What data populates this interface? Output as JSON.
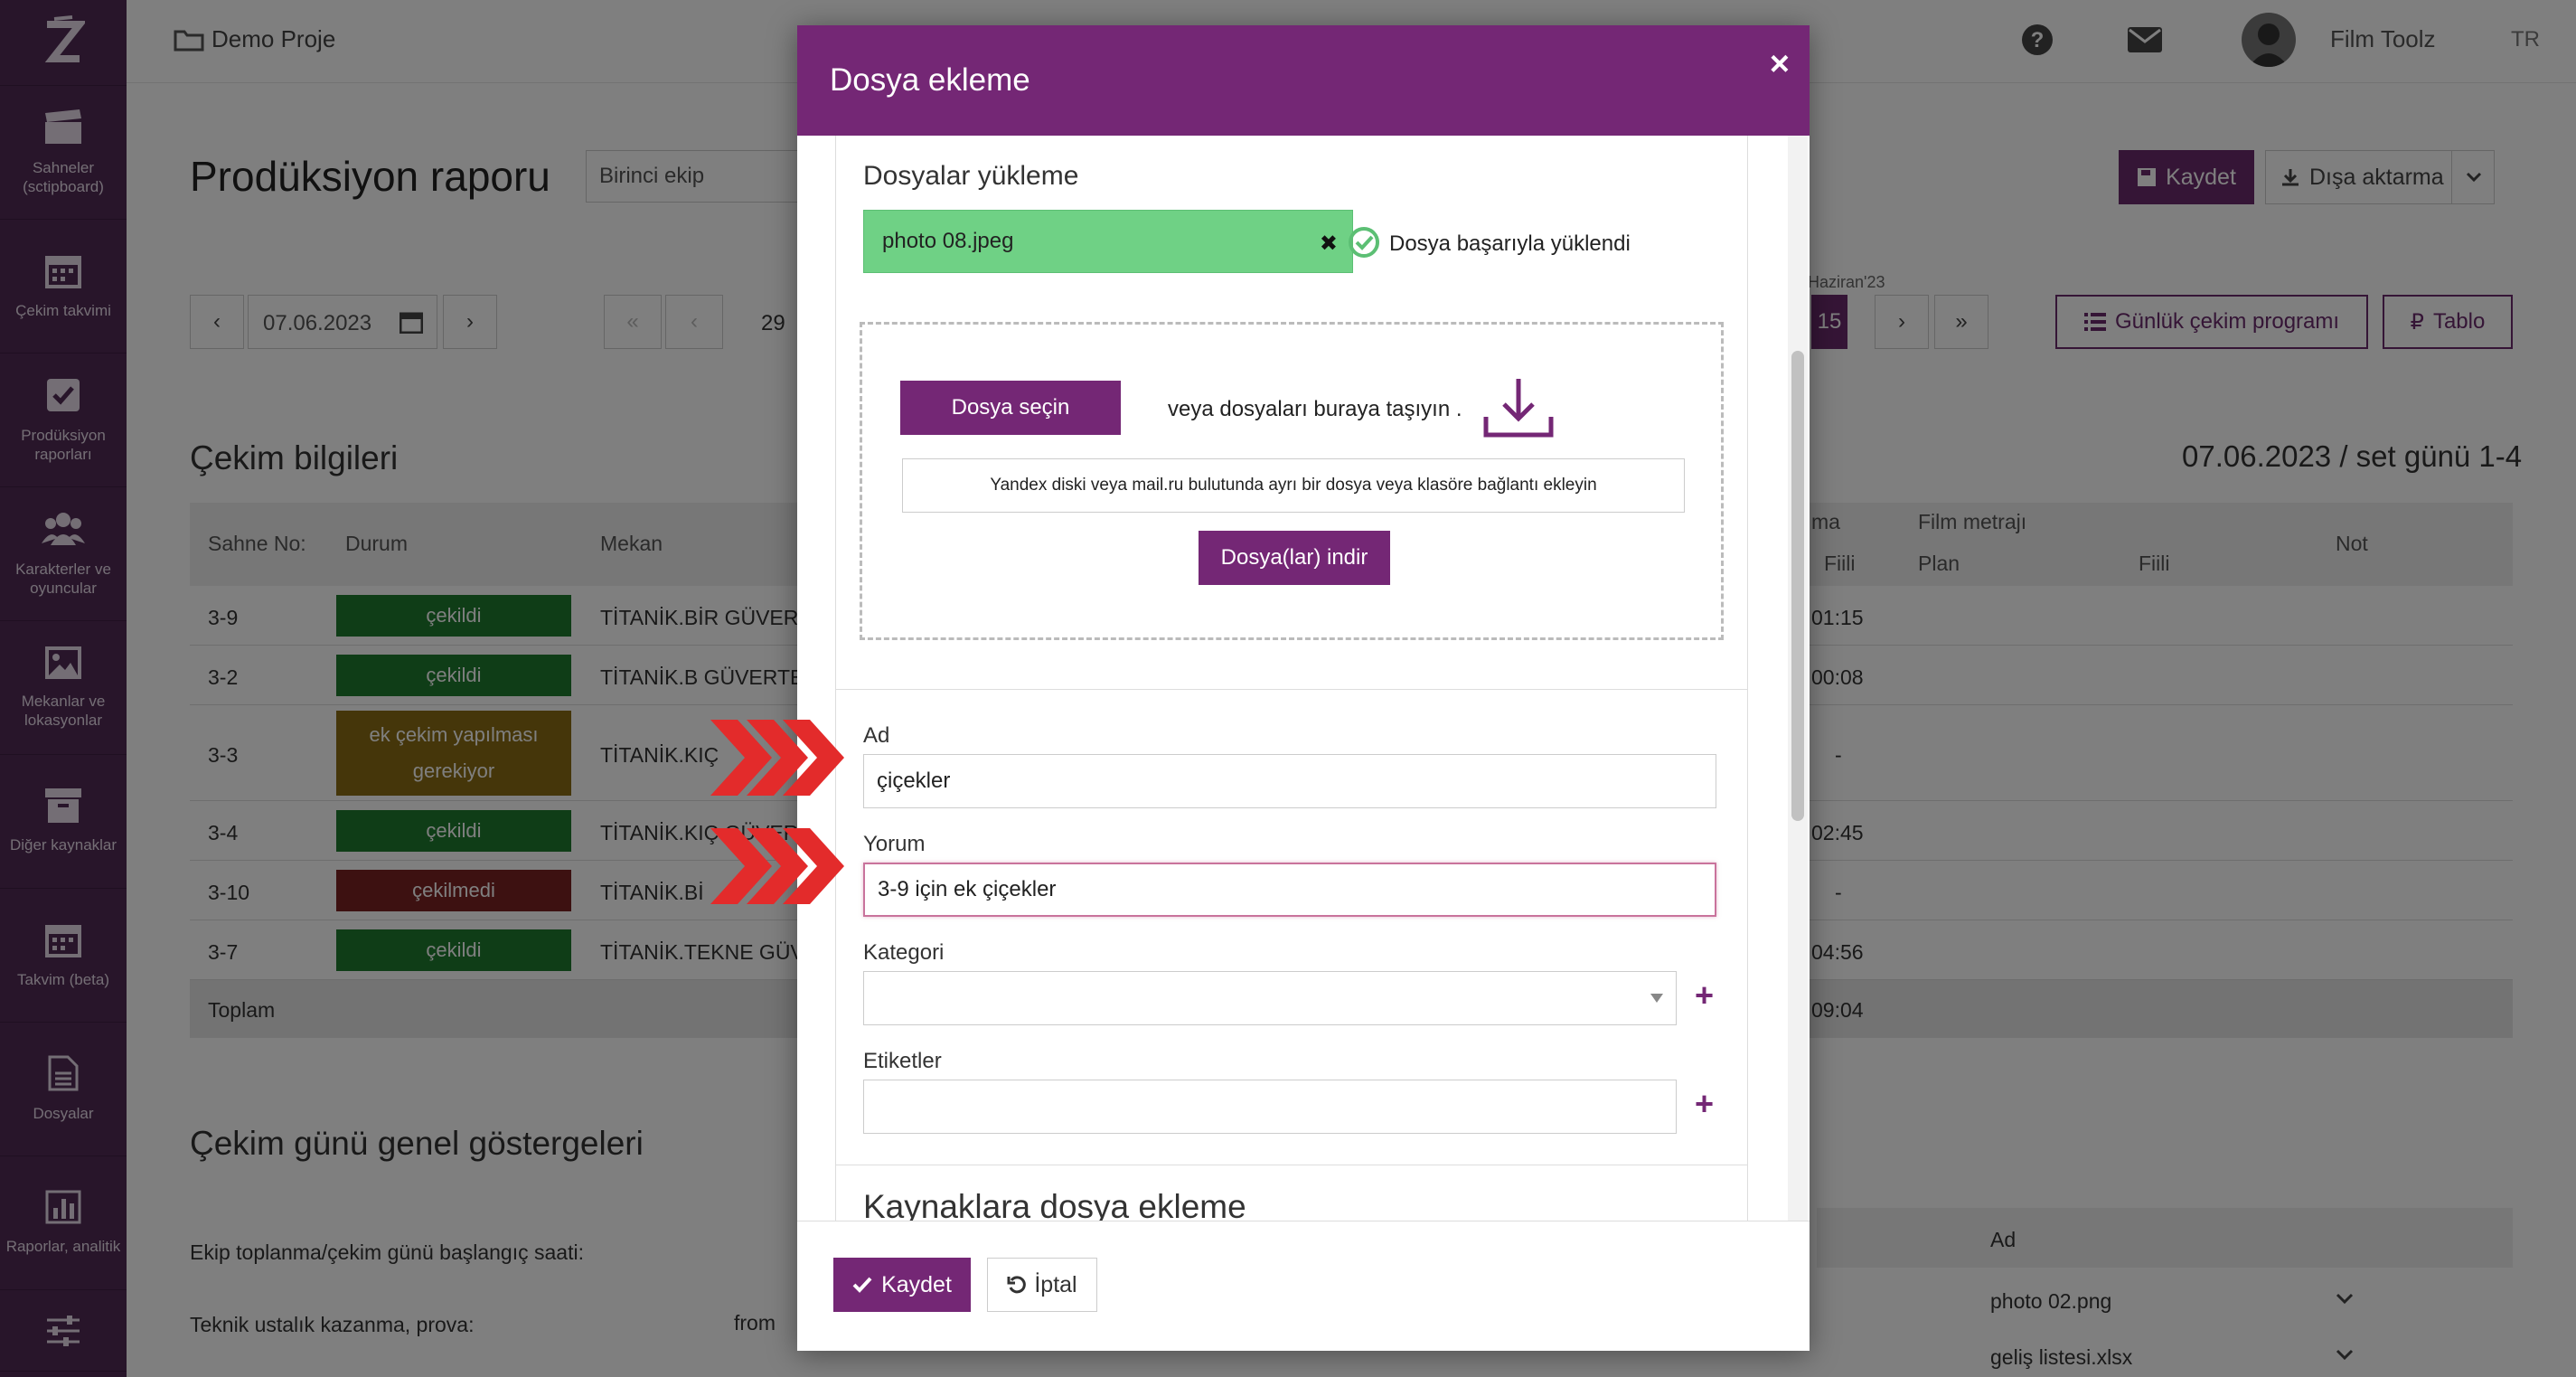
{
  "app": {
    "project_name": "Demo Proje",
    "user_name": "Film Toolz",
    "language": "TR"
  },
  "sidebar": {
    "items": [
      {
        "label": "Sahneler (sctipboard)"
      },
      {
        "label": "Çekim takvimi"
      },
      {
        "label": "Prodüksiyon raporları"
      },
      {
        "label": "Karakterler ve oyuncular"
      },
      {
        "label": "Mekanlar ve lokasyonlar"
      },
      {
        "label": "Diğer kaynaklar"
      },
      {
        "label": "Takvim (beta)"
      },
      {
        "label": "Dosyalar"
      },
      {
        "label": "Raporlar, analitik"
      }
    ]
  },
  "page": {
    "title": "Prodüksiyon raporu",
    "crew_select": "Birinci ekip",
    "save_label": "Kaydet",
    "export_label": "Dışa aktarma",
    "date_value": "07.06.2023",
    "day_number": "29",
    "month_label": "Haziran'23",
    "day_15": "15",
    "daily_schedule_label": "Günlük çekim programı",
    "table_label": "Tablo",
    "shoot_info_title": "Çekim bilgileri",
    "set_info": "07.06.2023 / set günü 1-4",
    "columns": {
      "scene": "Sahne No:",
      "status": "Durum",
      "location": "Mekan",
      "ma": "ma",
      "fiili1": "Fiili",
      "film_metraj": "Film metrajı",
      "plan": "Plan",
      "fiili2": "Fiili",
      "not": "Not"
    },
    "rows": [
      {
        "scene": "3-9",
        "status": "çekildi",
        "status_color": "#1f7a2e",
        "location": "TİTANİK.BİR GÜVERT",
        "time": "01:15"
      },
      {
        "scene": "3-2",
        "status": "çekildi",
        "status_color": "#1f7a2e",
        "location": "TİTANİK.B GÜVERTE",
        "time": "00:08"
      },
      {
        "scene": "3-3",
        "status": "ek çekim yapılması gerekiyor",
        "status_color": "#8a6d14",
        "location": "TİTANİK.KIÇ",
        "time": "-"
      },
      {
        "scene": "3-4",
        "status": "çekildi",
        "status_color": "#1f7a2e",
        "location": "TİTANİK.KIÇ GÜVER",
        "time": "02:45"
      },
      {
        "scene": "3-10",
        "status": "çekilmedi",
        "status_color": "#7a2323",
        "location": "TİTANİK.Bİ",
        "time": "-"
      },
      {
        "scene": "3-7",
        "status": "çekildi",
        "status_color": "#1f7a2e",
        "location": "TİTANİK.TEKNE GÜV",
        "time": "04:56"
      }
    ],
    "total_label": "Toplam",
    "total_time": "09:04",
    "general_title": "Çekim günü genel göstergeleri",
    "ekip_label": "Ekip toplanma/çekim günü başlangıç saati:",
    "teknik_label": "Teknik ustalık kazanma, prova:",
    "from_label": "from",
    "ad_col": "Ad",
    "files": [
      "photo 02.png",
      "geliş listesi.xlsx"
    ]
  },
  "modal": {
    "title": "Dosya ekleme",
    "upload_title": "Dosyalar yükleme",
    "file_name": "photo 08.jpeg",
    "upload_success": "Dosya başarıyla yüklendi",
    "choose_file": "Dosya seçin",
    "drop_text": "veya dosyaları buraya taşıyın .",
    "link_placeholder": "Yandex diski veya mail.ru bulutunda ayrı bir dosya veya klasöre bağlantı ekleyin",
    "download_files": "Dosya(lar) indir",
    "name_label": "Ad",
    "name_value": "çiçekler",
    "comment_label": "Yorum",
    "comment_value": "3-9 için ek çiçekler",
    "category_label": "Kategori",
    "tags_label": "Etiketler",
    "resources_title": "Kaynaklara dosya ekleme",
    "save_label": "Kaydet",
    "cancel_label": "İptal"
  },
  "colors": {
    "brand": "#742775",
    "sidebar": "#512a55",
    "success": "#6fd185",
    "arrow": "#e32b2b"
  }
}
